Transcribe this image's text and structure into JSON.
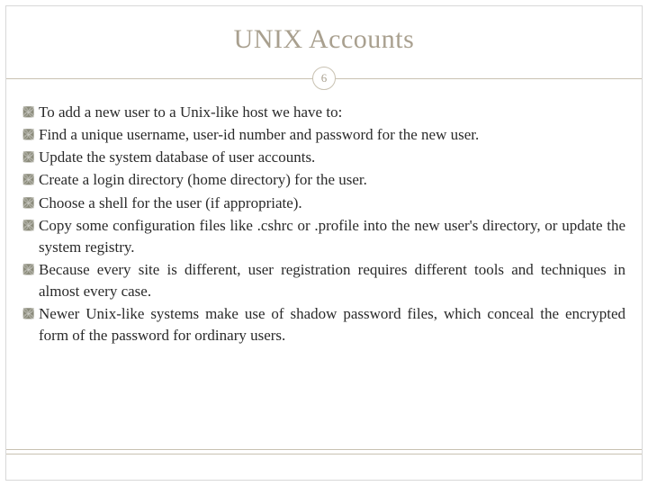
{
  "slide": {
    "title": "UNIX Accounts",
    "page_number": "6",
    "bullets": [
      "To add a new user to a Unix-like host we have to:",
      "Find a unique username, user-id number and password for the new user.",
      "Update the system database of user accounts.",
      "Create a login directory (home directory) for the user.",
      "Choose a shell for the user (if appropriate).",
      "Copy some configuration files like .cshrc or .profile into the new user's directory, or update the system registry.",
      "Because every site is different, user registration requires different tools and techniques in almost every case.",
      "Newer Unix-like systems make use of shadow password files, which conceal the encrypted form of the password for ordinary users."
    ]
  },
  "colors": {
    "title": "#a9a08f",
    "rule": "#c9c2b2",
    "text": "#2a2a2a"
  }
}
